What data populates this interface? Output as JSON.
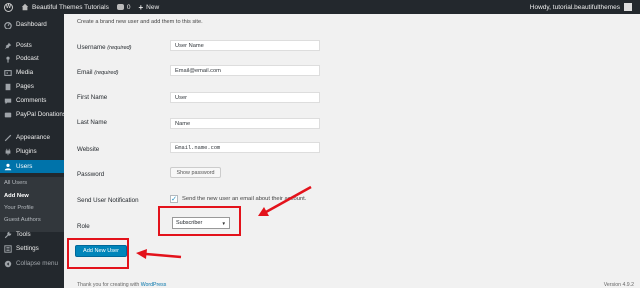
{
  "adminbar": {
    "site_name": "Beautiful Themes Tutorials",
    "comments_count": "0",
    "new_label": "New",
    "howdy": "Howdy, tutorial.beautifulthemes",
    "wp_logo_glyph": "W"
  },
  "sidebar": {
    "items": [
      {
        "label": "Dashboard",
        "icon": "dashboard-icon"
      },
      {
        "label": "Posts",
        "icon": "pin-icon"
      },
      {
        "label": "Podcast",
        "icon": "podcast-icon"
      },
      {
        "label": "Media",
        "icon": "media-icon"
      },
      {
        "label": "Pages",
        "icon": "pages-icon"
      },
      {
        "label": "Comments",
        "icon": "comment-icon"
      },
      {
        "label": "PayPal Donations",
        "icon": "paypal-icon"
      },
      {
        "label": "Appearance",
        "icon": "brush-icon"
      },
      {
        "label": "Plugins",
        "icon": "plug-icon"
      },
      {
        "label": "Users",
        "icon": "user-icon"
      },
      {
        "label": "Tools",
        "icon": "wrench-icon"
      },
      {
        "label": "Settings",
        "icon": "settings-icon"
      },
      {
        "label": "Collapse menu",
        "icon": "collapse-icon"
      }
    ],
    "submenu": [
      "All Users",
      "Add New",
      "Your Profile",
      "Guest Authors"
    ]
  },
  "form": {
    "intro": "Create a brand new user and add them to this site.",
    "username": {
      "label": "Username",
      "required": "(required)",
      "value": "User Name"
    },
    "email": {
      "label": "Email",
      "required": "(required)",
      "value": "Email@email.com"
    },
    "first_name": {
      "label": "First Name",
      "value": "User"
    },
    "last_name": {
      "label": "Last Name",
      "value": "Name"
    },
    "website": {
      "label": "Website",
      "value": "Email.name.com"
    },
    "password": {
      "label": "Password",
      "button": "Show password"
    },
    "notification": {
      "label": "Send User Notification",
      "checkbox_label": "Send the new user an email about their account.",
      "check_glyph": "✓"
    },
    "role": {
      "label": "Role",
      "value": "Subscriber"
    },
    "submit": "Add New User"
  },
  "footer": {
    "thanks_prefix": "Thank you for creating with",
    "wordpress_link": "WordPress",
    "version": "Version 4.9.2"
  },
  "colors": {
    "admin_bar": "#23282d",
    "sidebar": "#23282d",
    "current_menu": "#0073aa",
    "primary_button": "#0085ba",
    "annotation_red": "#e3121b"
  }
}
